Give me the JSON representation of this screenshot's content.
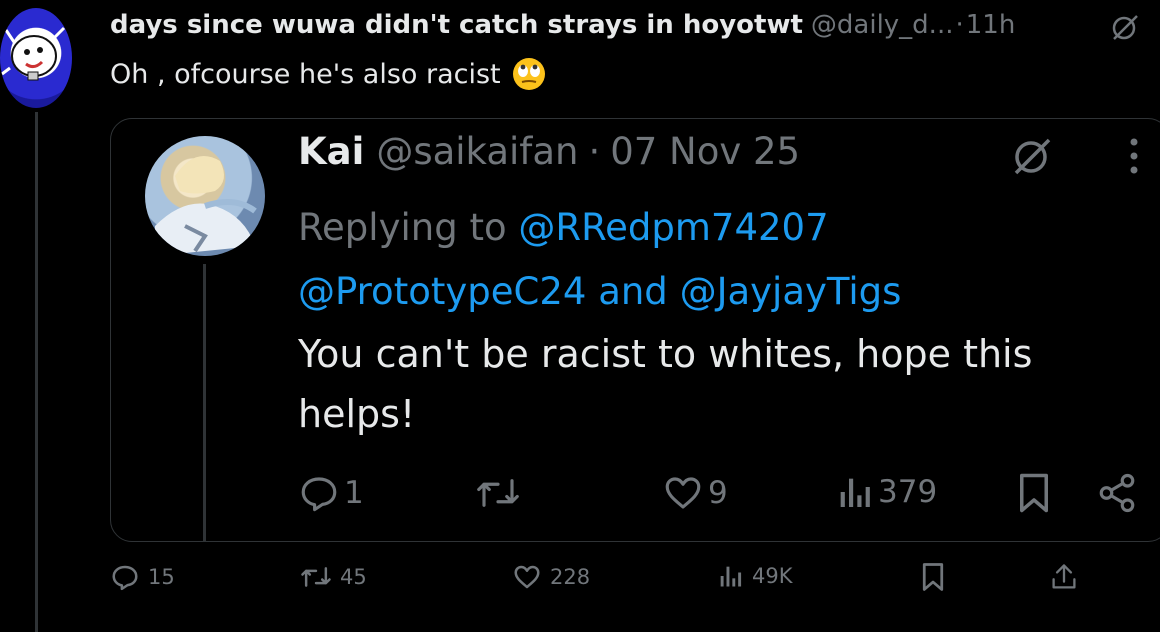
{
  "post": {
    "display_name": "days since wuwa didn't catch strays in hoyotwt",
    "handle": "@daily_d...",
    "separator": "·",
    "time": "11h",
    "text": "Oh , ofcourse he's also racist",
    "emoji": "face-with-rolling-eyes-emoji",
    "actions": {
      "replies": "15",
      "reposts": "45",
      "likes": "228",
      "views": "49K"
    }
  },
  "quote": {
    "display_name": "Kai",
    "handle": "@saikaifan",
    "separator": "·",
    "date": "07 Nov 25",
    "replying_prefix": "Replying to",
    "mention_1": "@RRedpm74207",
    "mention_2": "@PrototypeC24",
    "mention_joiner": "and",
    "mention_3": "@JayjayTigs",
    "body": "You can't be racist to whites, hope this helps!",
    "actions": {
      "replies": "1",
      "likes": "9",
      "views": "379"
    }
  },
  "colors": {
    "background": "#000000",
    "text": "#e7e9ea",
    "muted": "#71767b",
    "mention": "#1d9bf0",
    "border": "#2f3336"
  }
}
